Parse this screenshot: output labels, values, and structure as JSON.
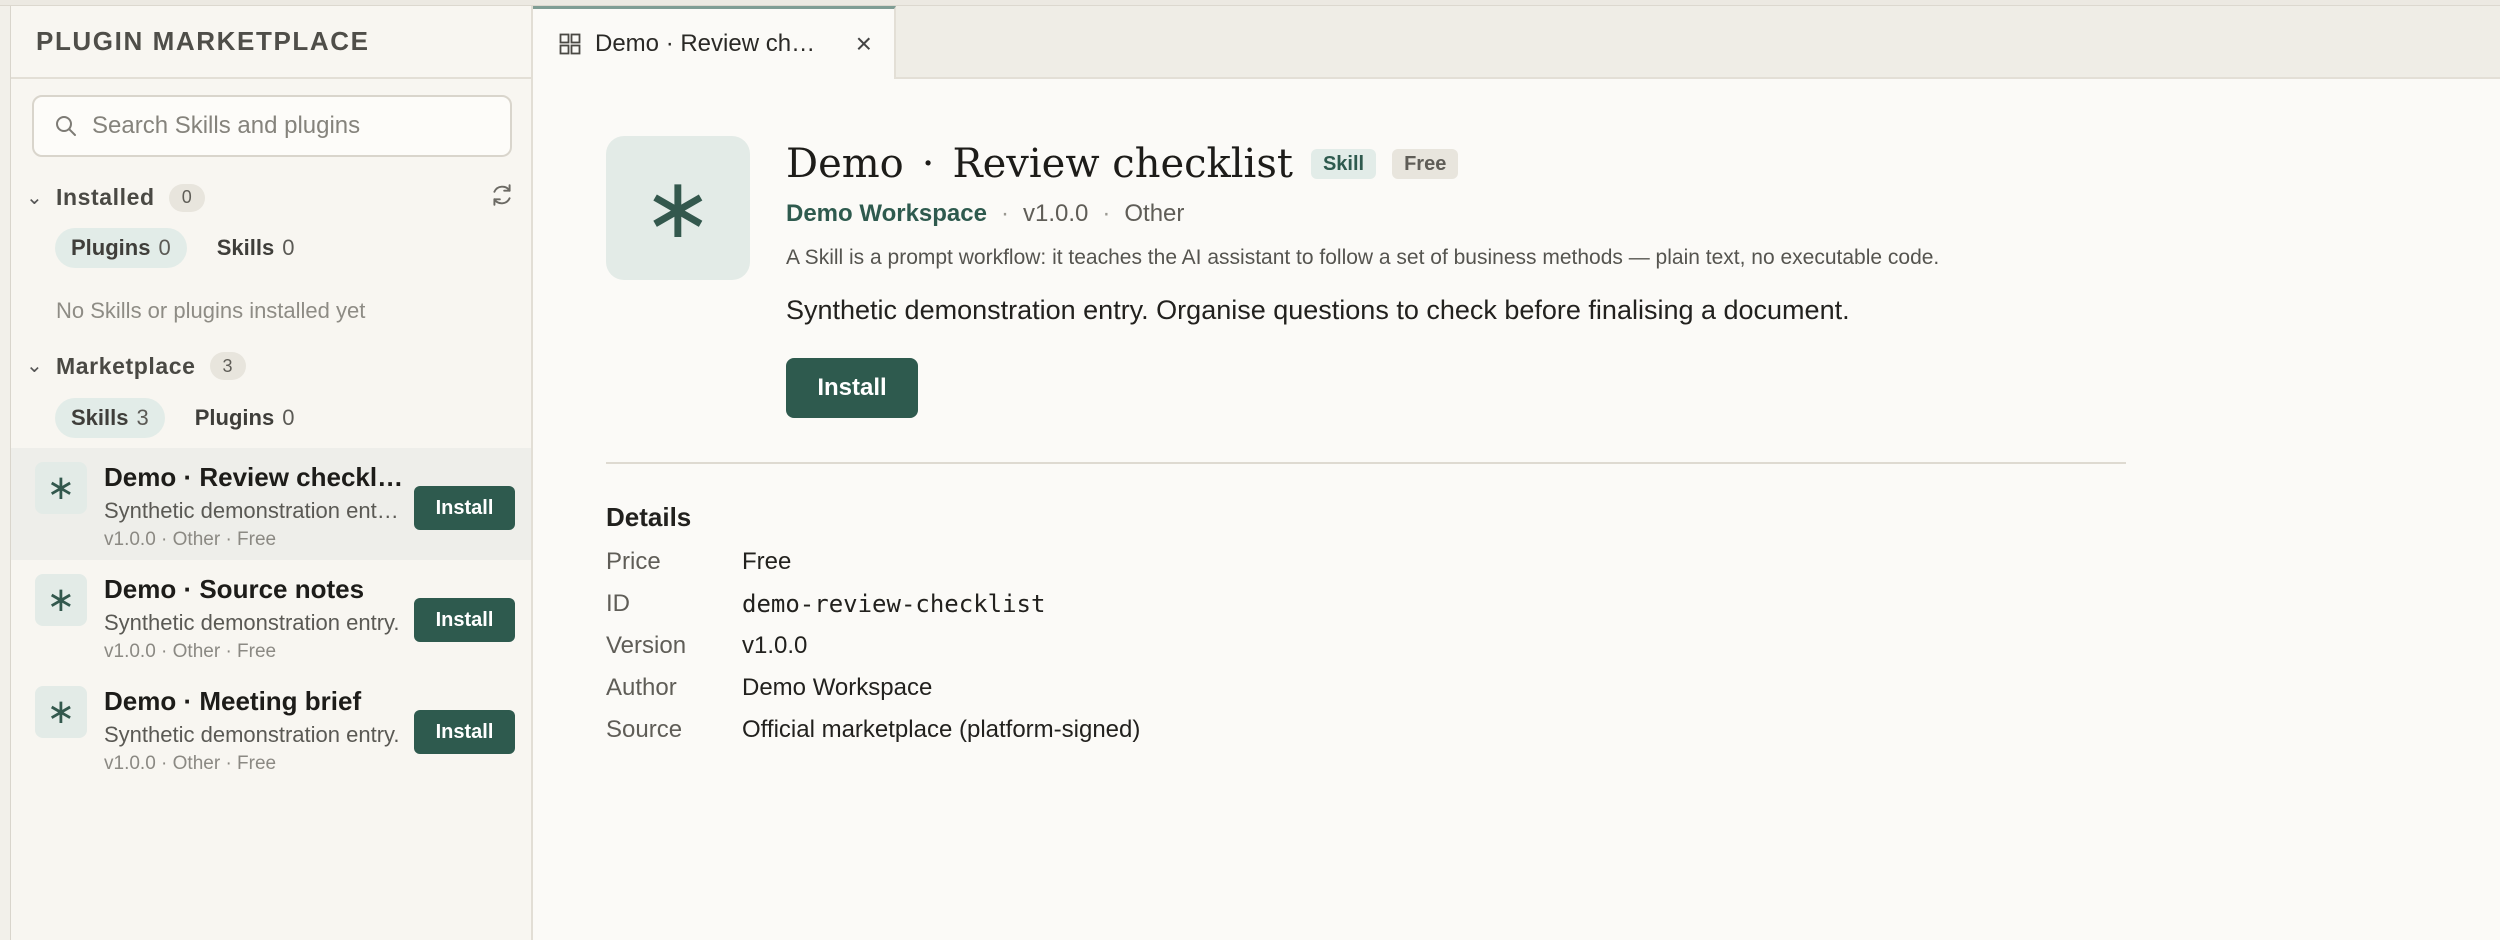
{
  "sidebar": {
    "title": "PLUGIN MARKETPLACE",
    "search_placeholder": "Search Skills and plugins",
    "installed": {
      "label": "Installed",
      "count": "0",
      "tabs": [
        {
          "label": "Plugins",
          "count": "0",
          "active": true
        },
        {
          "label": "Skills",
          "count": "0",
          "active": false
        }
      ],
      "empty_text": "No Skills or plugins installed yet"
    },
    "marketplace": {
      "label": "Marketplace",
      "count": "3",
      "tabs": [
        {
          "label": "Skills",
          "count": "3",
          "active": true
        },
        {
          "label": "Plugins",
          "count": "0",
          "active": false
        }
      ],
      "items": [
        {
          "title": "Demo · Review checklist",
          "desc": "Synthetic demonstration entry. Organise questions to check before finalising a document.",
          "meta": "v1.0.0 · Other · Free",
          "button": "Install",
          "selected": true
        },
        {
          "title": "Demo · Source notes",
          "desc": "Synthetic demonstration entry.",
          "meta": "v1.0.0 · Other · Free",
          "button": "Install",
          "selected": false
        },
        {
          "title": "Demo · Meeting brief",
          "desc": "Synthetic demonstration entry.",
          "meta": "v1.0.0 · Other · Free",
          "button": "Install",
          "selected": false
        }
      ]
    }
  },
  "tab": {
    "label": "Demo · Review checklist",
    "close": "×"
  },
  "detail": {
    "icon_glyph": "∗",
    "title_prefix": "Demo",
    "title_sep": "·",
    "title_main": "Review checklist",
    "tag_type": "Skill",
    "tag_price": "Free",
    "author": "Demo Workspace",
    "version": "v1.0.0",
    "category": "Other",
    "meta_sep": "·",
    "explain": "A Skill is a prompt workflow: it teaches the AI assistant to follow a set of business methods — plain text, no executable code.",
    "description": "Synthetic demonstration entry. Organise questions to check before finalising a document.",
    "install_label": "Install",
    "details_title": "Details",
    "rows": [
      {
        "key": "Price",
        "value": "Free"
      },
      {
        "key": "ID",
        "value": "demo-review-checklist"
      },
      {
        "key": "Version",
        "value": "v1.0.0"
      },
      {
        "key": "Author",
        "value": "Demo Workspace"
      },
      {
        "key": "Source",
        "value": "Official marketplace (platform-signed)"
      }
    ]
  },
  "colors": {
    "accent": "#2e5a4e",
    "accent_soft": "#e2ece8",
    "background": "#fbfaf7"
  },
  "icons": {
    "search": "search-icon",
    "refresh": "refresh-icon",
    "chevron": "chevron-down-icon",
    "tab": "grid-icon",
    "close": "close-icon",
    "skill": "asterisk-icon"
  }
}
